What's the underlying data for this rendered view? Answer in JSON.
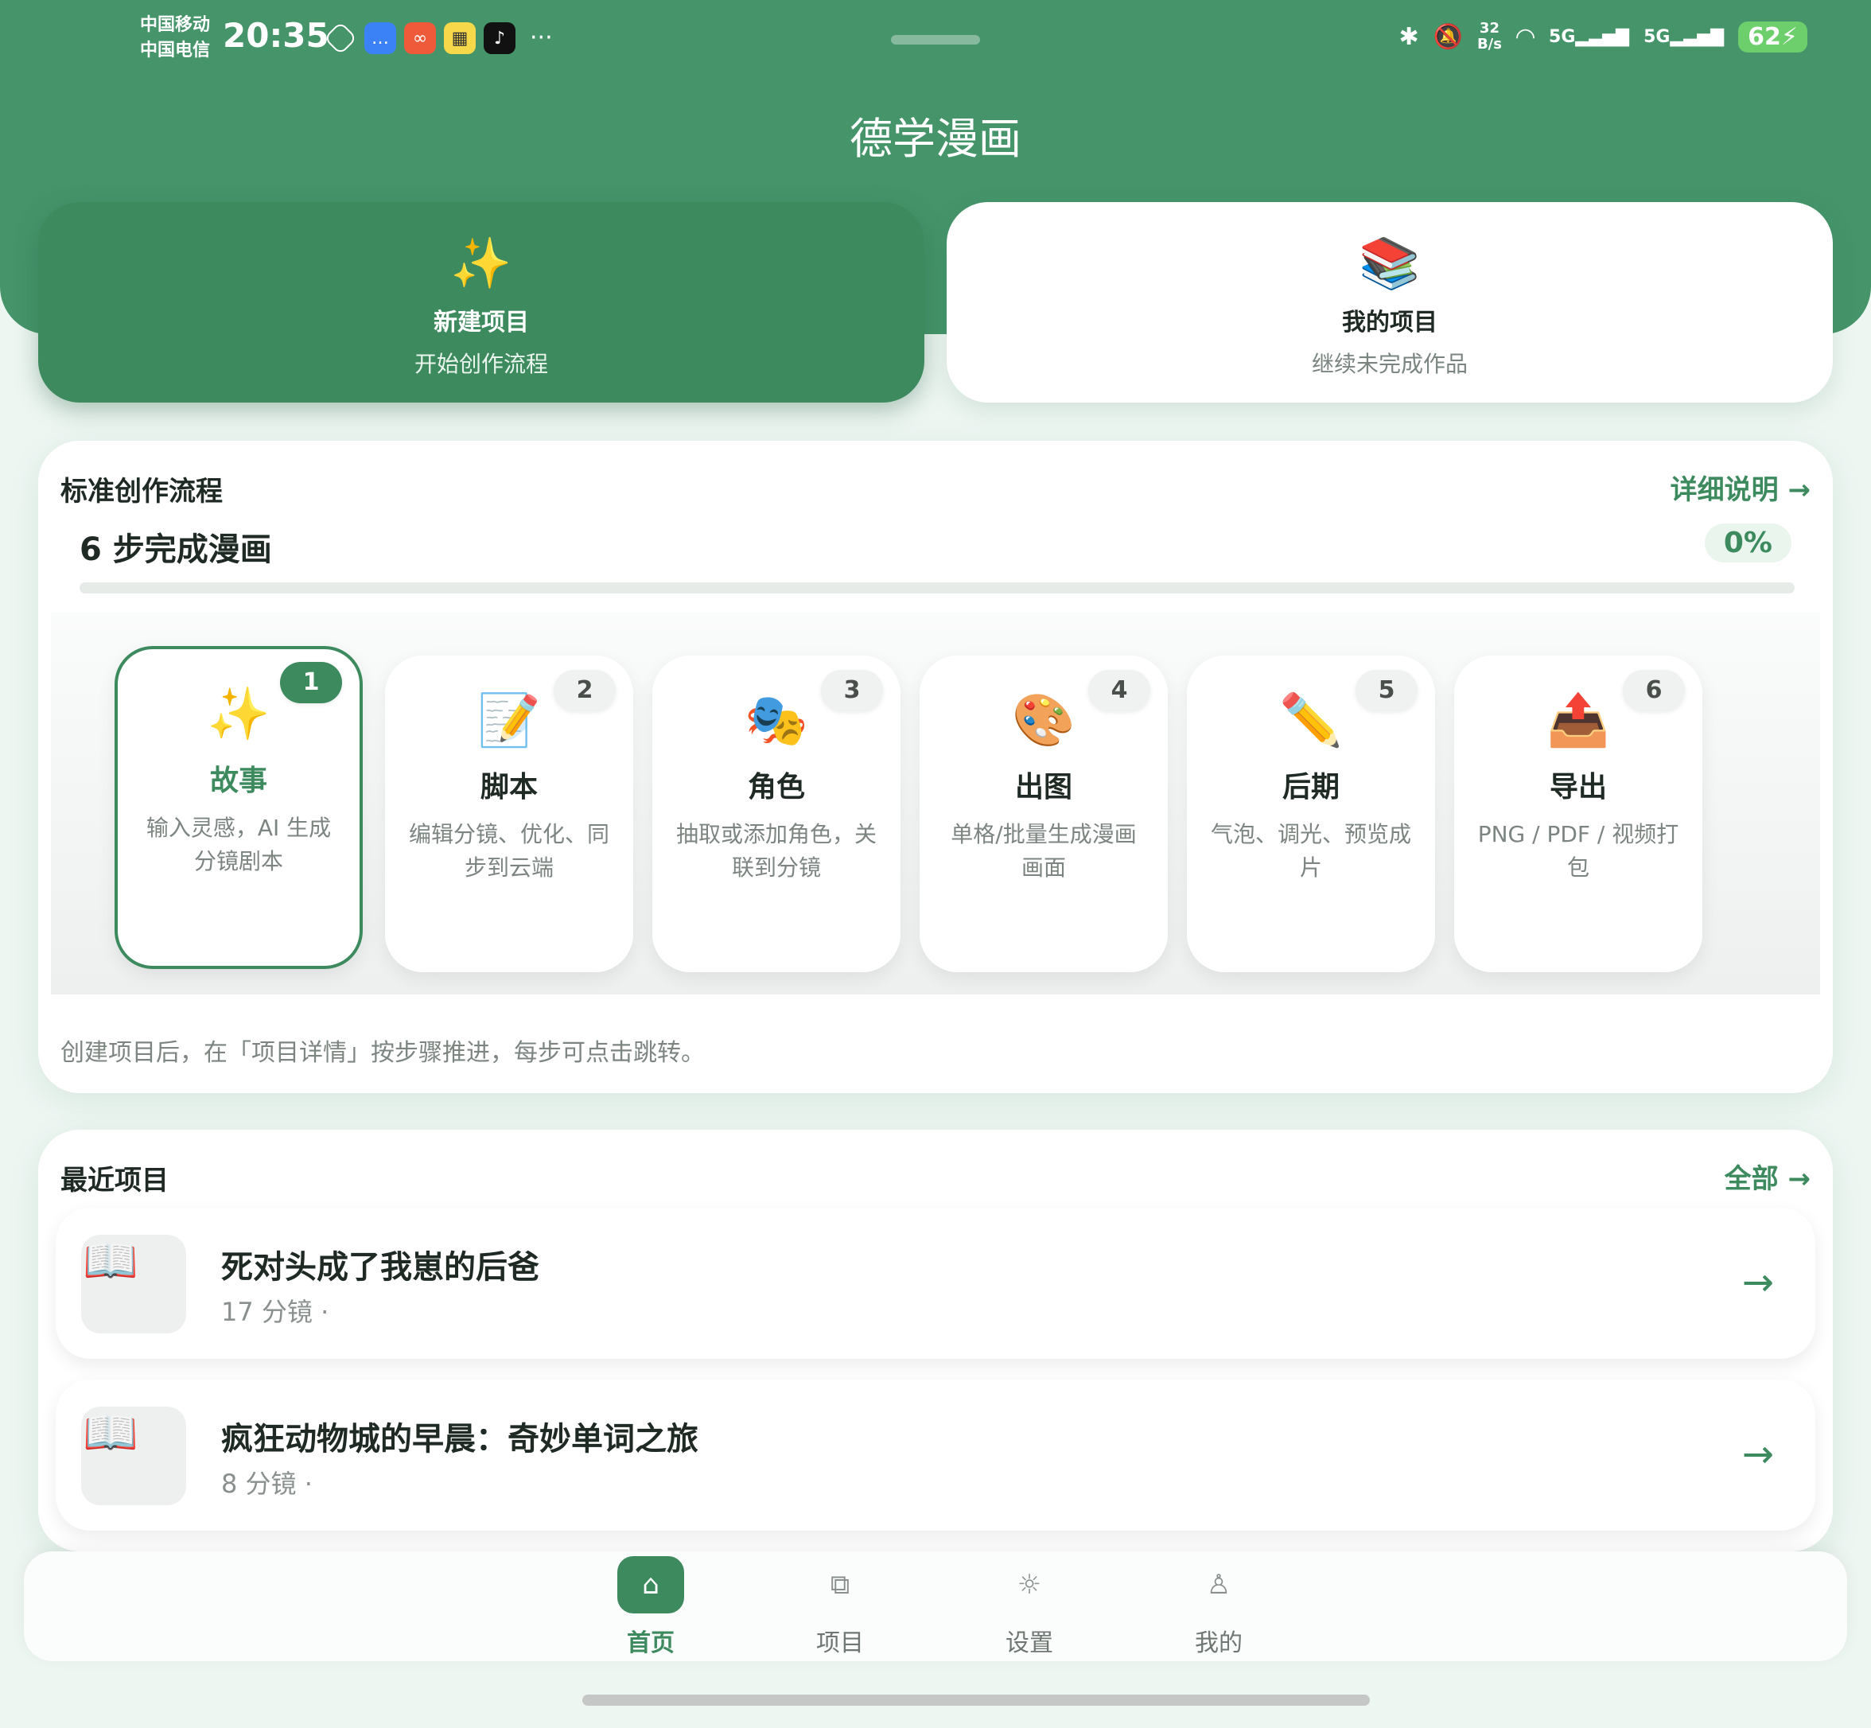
{
  "status_bar": {
    "carrier_1": "中国移动",
    "carrier_2": "中国电信",
    "time": "20:35",
    "notif_icons": [
      "app-icon",
      "message-icon",
      "app-grid-icon",
      "yellow-app-icon",
      "tiktok-icon"
    ],
    "more": "···",
    "net_speed_value": "32",
    "net_speed_unit": "B/s",
    "signal_1": "5G",
    "signal_2": "5G",
    "battery": "62"
  },
  "header": {
    "title": "德学漫画"
  },
  "actions": {
    "new_project": {
      "icon": "✨",
      "title": "新建项目",
      "subtitle": "开始创作流程"
    },
    "my_projects": {
      "icon": "📚",
      "title": "我的项目",
      "subtitle": "继续未完成作品"
    }
  },
  "workflow": {
    "title": "标准创作流程",
    "link": "详细说明 →",
    "progress_label": "6 步完成漫画",
    "progress_percent": "0%",
    "progress_value": 0,
    "steps": [
      {
        "num": "1",
        "icon": "✨",
        "name": "故事",
        "desc": "输入灵感，AI 生成分镜剧本"
      },
      {
        "num": "2",
        "icon": "📝",
        "name": "脚本",
        "desc": "编辑分镜、优化、同步到云端"
      },
      {
        "num": "3",
        "icon": "🎭",
        "name": "角色",
        "desc": "抽取或添加角色，关联到分镜"
      },
      {
        "num": "4",
        "icon": "🎨",
        "name": "出图",
        "desc": "单格/批量生成漫画画面"
      },
      {
        "num": "5",
        "icon": "✏️",
        "name": "后期",
        "desc": "气泡、调光、预览成片"
      },
      {
        "num": "6",
        "icon": "📤",
        "name": "导出",
        "desc": "PNG / PDF / 视频打包"
      }
    ],
    "hint": "创建项目后，在「项目详情」按步骤推进，每步可点击跳转。"
  },
  "recent": {
    "title": "最近项目",
    "link": "全部 →",
    "projects": [
      {
        "thumb": "📖",
        "title": "死对头成了我崽的后爸",
        "meta": "17 分镜 ·",
        "arrow": "→"
      },
      {
        "thumb": "📖",
        "title": "疯狂动物城的早晨：奇妙单词之旅",
        "meta": "8 分镜 ·",
        "arrow": "→"
      }
    ]
  },
  "nav": {
    "items": [
      {
        "icon": "⌂",
        "label": "首页",
        "active": true
      },
      {
        "icon": "⧉",
        "label": "项目",
        "active": false
      },
      {
        "icon": "☼",
        "label": "设置",
        "active": false
      },
      {
        "icon": "♙",
        "label": "我的",
        "active": false
      }
    ]
  },
  "colors": {
    "primary": "#3d8a5f",
    "header": "#45946a",
    "background": "#eef6f2"
  }
}
